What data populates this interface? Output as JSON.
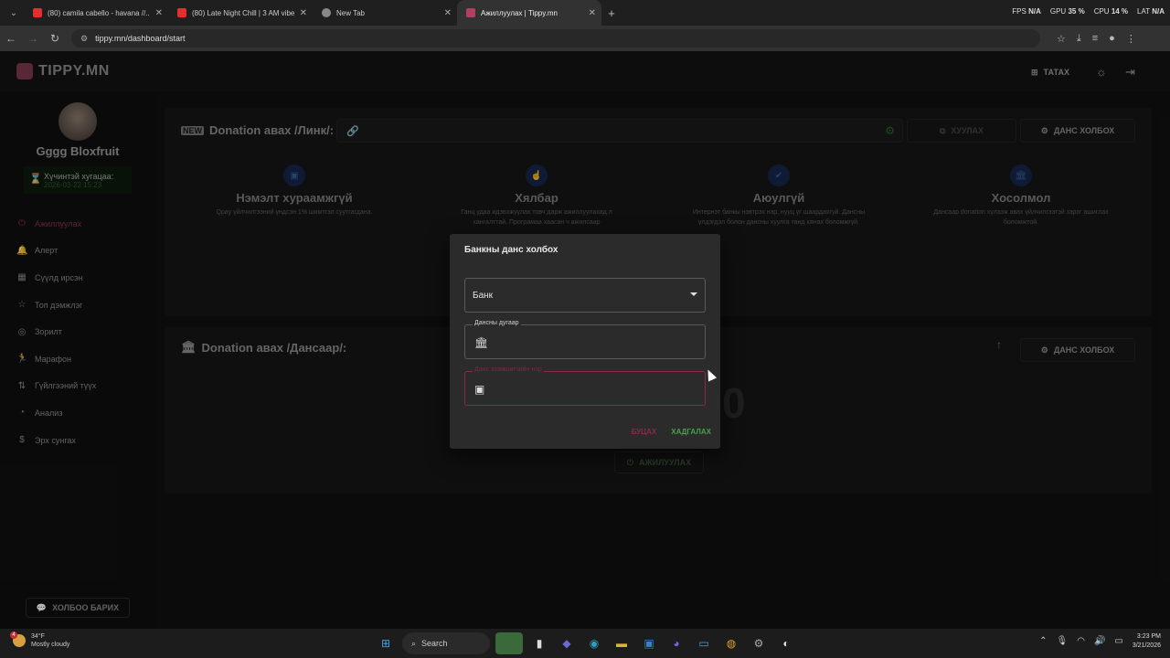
{
  "browser": {
    "tabs": [
      {
        "title": "(80) camila cabello - havana //...",
        "color": "#e03030"
      },
      {
        "title": "(80) Late Night Chill | 3 AM vibe",
        "color": "#e03030"
      },
      {
        "title": "New Tab",
        "color": "#888888"
      },
      {
        "title": "Ажиллуулах | Tippy.mn",
        "color": "#b04060"
      }
    ],
    "url": "tippy.mn/dashboard/start",
    "stats": {
      "fps_label": "FPS",
      "fps": "N/A",
      "gpu_label": "GPU",
      "gpu": "35 %",
      "cpu_label": "CPU",
      "cpu": "14 %",
      "lat_label": "LAT",
      "lat": "N/A"
    }
  },
  "app": {
    "logo": "TIPPY.MN",
    "header_button": "ТАТАХ",
    "user": {
      "name": "Gggg Bloxfruit",
      "validity_label": "Хүчинтэй хугацаа:",
      "validity_date": "2026-03-22 15:23"
    },
    "menu": [
      {
        "label": "Ажиллуулах",
        "icon": "power-icon",
        "glyph": "⏻",
        "active": true
      },
      {
        "label": "Алерт",
        "icon": "bell-icon",
        "glyph": "🔔",
        "active": false
      },
      {
        "label": "Сүүлд ирсэн",
        "icon": "calendar-icon",
        "glyph": "▦",
        "active": false
      },
      {
        "label": "Топ дэмжлэг",
        "icon": "star-icon",
        "glyph": "☆",
        "active": false
      },
      {
        "label": "Зорилт",
        "icon": "target-icon",
        "glyph": "◎",
        "active": false
      },
      {
        "label": "Марафон",
        "icon": "runner-icon",
        "glyph": "🏃",
        "active": false
      },
      {
        "label": "Гүйлгээний түүх",
        "icon": "history-icon",
        "glyph": "⇅",
        "active": false
      },
      {
        "label": "Анализ",
        "icon": "chart-icon",
        "glyph": "◔",
        "active": false
      },
      {
        "label": "Эрх сунгах",
        "icon": "dollar-icon",
        "glyph": "$",
        "active": false
      }
    ],
    "chat_button": "ХОЛБОО БАРИХ",
    "card_link": {
      "title": "Donation авах /Линк/:",
      "copy_button": "ХУУЛАХ",
      "connect_button": "ДАНС ХОЛБОХ",
      "features": [
        {
          "title": "Нэмэлт хураамжгүй",
          "desc": "Qpay үйлчилгээний үндсэн 1% шимтгэл суутгагдана.",
          "icon": "qr-icon",
          "glyph": "▣"
        },
        {
          "title": "Хялбар",
          "desc": "Ганц удаа идэвхжүүлах товч дарж ажиллуулахад л хангалттай. Програмаа хаасан ч ажилсаар",
          "icon": "hand-icon",
          "glyph": "☝"
        },
        {
          "title": "Аюулгүй",
          "desc": "Интернэт банкы нэвтрэх нэр, нууц үг шаардахгүй. Дансны үлдэгдэл болон дансны хуулга танд хянах боломжгүй.",
          "icon": "shield-icon",
          "glyph": "✔"
        },
        {
          "title": "Хосолмол",
          "desc": "Дансаар donation хүлээж авах үйлчилгээтэй зэрэг ашиглах боломжтой.",
          "icon": "bank-icon",
          "glyph": "🏛"
        }
      ]
    },
    "card_bank": {
      "title": "Donation авах /Дансаар/:",
      "connect_button": "ДАНС ХОЛБОХ",
      "big_value": "0",
      "activate_button": "АЖИЛУУЛАХ"
    }
  },
  "modal": {
    "title": "Банкны данс холбох",
    "bank_select": "Банк",
    "account_label": "Дансны дугаар",
    "owner_label": "Данс эзэмшигчийн нэр",
    "cancel": "БУЦАХ",
    "save": "ХАДГАЛАХ"
  },
  "taskbar": {
    "temp": "34°F",
    "weather": "Mostly cloudy",
    "badge": "4",
    "search": "Search",
    "time": "3:23 PM",
    "date": "3/21/2026"
  }
}
